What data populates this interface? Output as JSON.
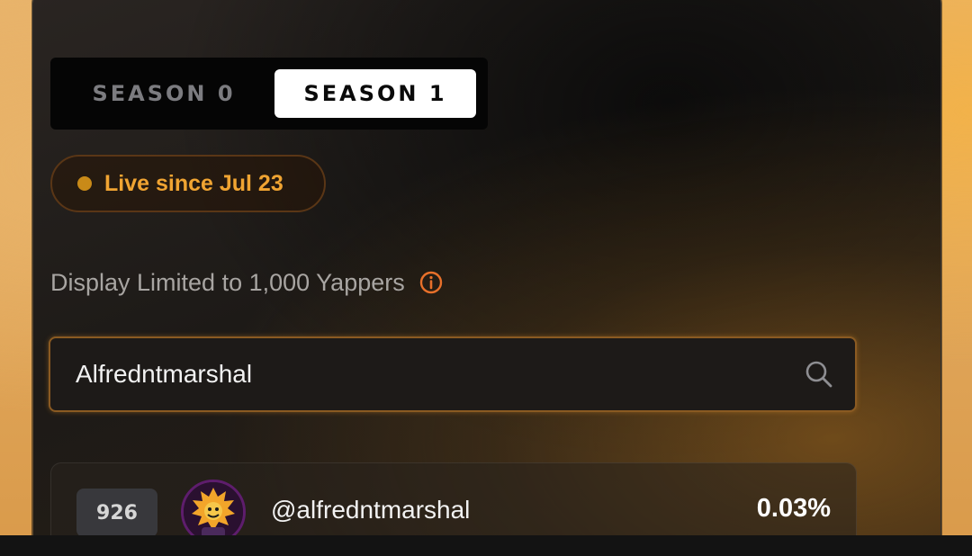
{
  "seasons": {
    "tabs": [
      {
        "label": "SEASON 0",
        "selected": false
      },
      {
        "label": "SEASON 1",
        "selected": true
      }
    ]
  },
  "live_badge": {
    "text": "Live since Jul 23",
    "accent_color": "#f0a432",
    "dot_color": "#c98a18"
  },
  "display_note": {
    "text": "Display Limited to 1,000 Yappers",
    "icon": "info-icon"
  },
  "search": {
    "value": "Alfredntmarshal",
    "icon": "search-icon"
  },
  "results": [
    {
      "rank": "926",
      "handle": "@alfredntmarshal",
      "percent": "0.03%",
      "avatar": "avatar"
    }
  ]
}
